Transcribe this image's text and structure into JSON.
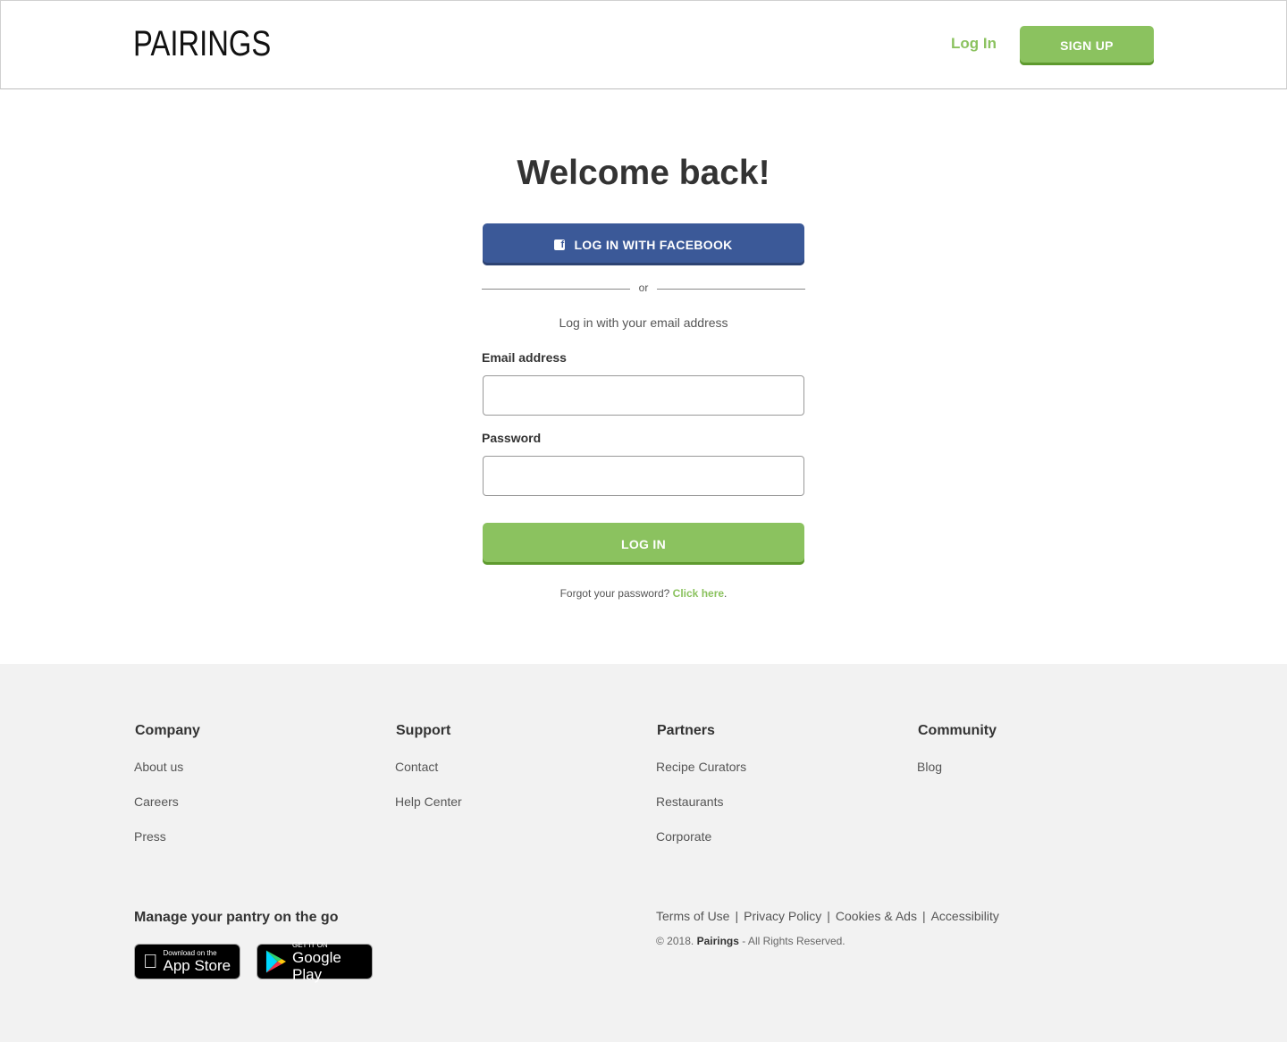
{
  "header": {
    "logo": "PAIRINGS",
    "login_label": "Log In",
    "signup_label": "SIGN UP"
  },
  "main": {
    "title": "Welcome back!",
    "facebook_label": "LOG IN WITH FACEBOOK",
    "divider": "or",
    "subtitle": "Log in with your email address",
    "email_label": "Email address",
    "email_value": "",
    "password_label": "Password",
    "password_value": "",
    "login_button": "LOG IN",
    "forgot_text": "Forgot your password?",
    "forgot_link": "Click here",
    "forgot_period": "."
  },
  "footer": {
    "columns": [
      {
        "title": "Company",
        "links": [
          "About us",
          "Careers",
          "Press"
        ]
      },
      {
        "title": "Support",
        "links": [
          "Contact",
          "Help Center"
        ]
      },
      {
        "title": "Partners",
        "links": [
          "Recipe Curators",
          "Restaurants",
          "Corporate"
        ]
      },
      {
        "title": "Community",
        "links": [
          "Blog"
        ]
      }
    ],
    "pantry_title": "Manage your pantry on the go",
    "app_store": {
      "small": "Download on the",
      "big": "App Store"
    },
    "google_play": {
      "small": "GET IT ON",
      "big": "Google Play"
    },
    "legal_links": [
      "Terms of Use",
      "Privacy Policy",
      "Cookies & Ads",
      "Accessibility"
    ],
    "legal_separator": "|",
    "copyright_prefix": "© 2018.",
    "copyright_brand": "Pairings",
    "copyright_suffix": "- All Rights Reserved."
  },
  "colors": {
    "brand_green": "#8bc25f",
    "facebook_blue": "#3b5998",
    "footer_bg": "#f2f2f2"
  }
}
